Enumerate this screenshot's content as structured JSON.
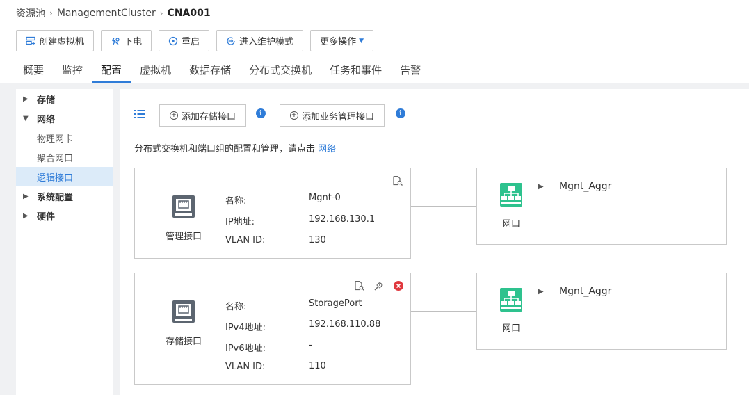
{
  "breadcrumb": {
    "root": "资源池",
    "cluster": "ManagementCluster",
    "current": "CNA001"
  },
  "toolbar": {
    "create_vm": "创建虚拟机",
    "power_off": "下电",
    "restart": "重启",
    "maintenance": "进入维护模式",
    "more": "更多操作"
  },
  "tabs": [
    "概要",
    "监控",
    "配置",
    "虚拟机",
    "数据存储",
    "分布式交换机",
    "任务和事件",
    "告警"
  ],
  "active_tab": "配置",
  "sidebar": {
    "storage": "存储",
    "network": "网络",
    "physical_nic": "物理网卡",
    "aggregated_port": "聚合网口",
    "logical_interface": "逻辑接口",
    "system_config": "系统配置",
    "hardware": "硬件"
  },
  "actions": {
    "add_storage_iface": "添加存储接口",
    "add_mgmt_iface": "添加业务管理接口"
  },
  "hint": {
    "text": "分布式交换机和端口组的配置和管理，请点击",
    "link": "网络"
  },
  "interfaces": [
    {
      "caption": "管理接口",
      "rows": [
        {
          "label": "名称:",
          "value": "Mgnt-0"
        },
        {
          "label": "IP地址:",
          "value": "192.168.130.1"
        },
        {
          "label": "VLAN ID:",
          "value": "130"
        }
      ],
      "port": {
        "caption": "网口",
        "name": "Mgnt_Aggr"
      }
    },
    {
      "caption": "存储接口",
      "rows": [
        {
          "label": "名称:",
          "value": "StoragePort"
        },
        {
          "label": "IPv4地址:",
          "value": "192.168.110.88"
        },
        {
          "label": "IPv6地址:",
          "value": "-"
        },
        {
          "label": "VLAN ID:",
          "value": "110"
        }
      ],
      "port": {
        "caption": "网口",
        "name": "Mgnt_Aggr"
      }
    }
  ],
  "colors": {
    "accent": "#2f7cd8",
    "port_green": "#2ec28e",
    "delete_red": "#e0383e"
  },
  "icons": [
    "create-vm-icon",
    "power-off-icon",
    "restart-icon",
    "maintenance-icon",
    "list-icon",
    "info-icon",
    "ethernet-port-icon",
    "detail-icon",
    "network-switch-icon",
    "delete-icon"
  ]
}
